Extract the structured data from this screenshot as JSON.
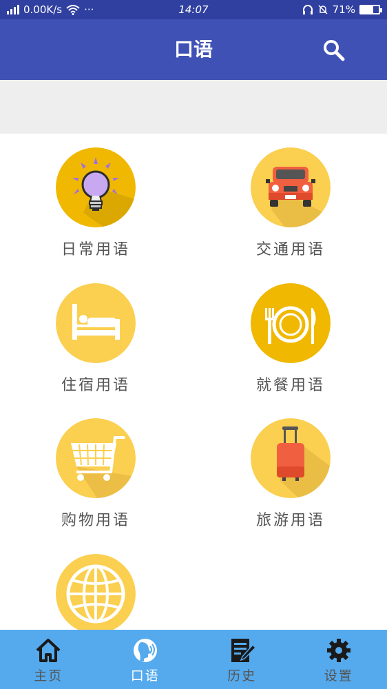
{
  "status": {
    "network": "2G",
    "speed": "0.00K/s",
    "more": "···",
    "time": "14:07",
    "battery": "71%",
    "battery_level": 0.71
  },
  "app_bar": {
    "title": "口语",
    "search_icon": "search-icon",
    "color": "#3f51b5"
  },
  "categories": [
    {
      "label": "日常用语",
      "icon": "lightbulb-icon"
    },
    {
      "label": "交通用语",
      "icon": "car-icon"
    },
    {
      "label": "住宿用语",
      "icon": "bed-icon"
    },
    {
      "label": "就餐用语",
      "icon": "plate-cutlery-icon"
    },
    {
      "label": "购物用语",
      "icon": "shopping-cart-icon"
    },
    {
      "label": "旅游用语",
      "icon": "suitcase-icon"
    },
    {
      "label": "",
      "icon": "globe-icon"
    }
  ],
  "bottom_nav": {
    "active": "口语",
    "items": [
      {
        "label": "主页",
        "icon": "home-icon"
      },
      {
        "label": "口语",
        "icon": "speaking-icon"
      },
      {
        "label": "历史",
        "icon": "history-icon"
      },
      {
        "label": "设置",
        "icon": "gear-icon"
      }
    ]
  },
  "colors": {
    "status_bar": "#3040a0",
    "app_bar": "#3f51b5",
    "icon_circle": "#fbcf4f",
    "bottom_nav": "#55aaee",
    "label_text": "#555555"
  }
}
